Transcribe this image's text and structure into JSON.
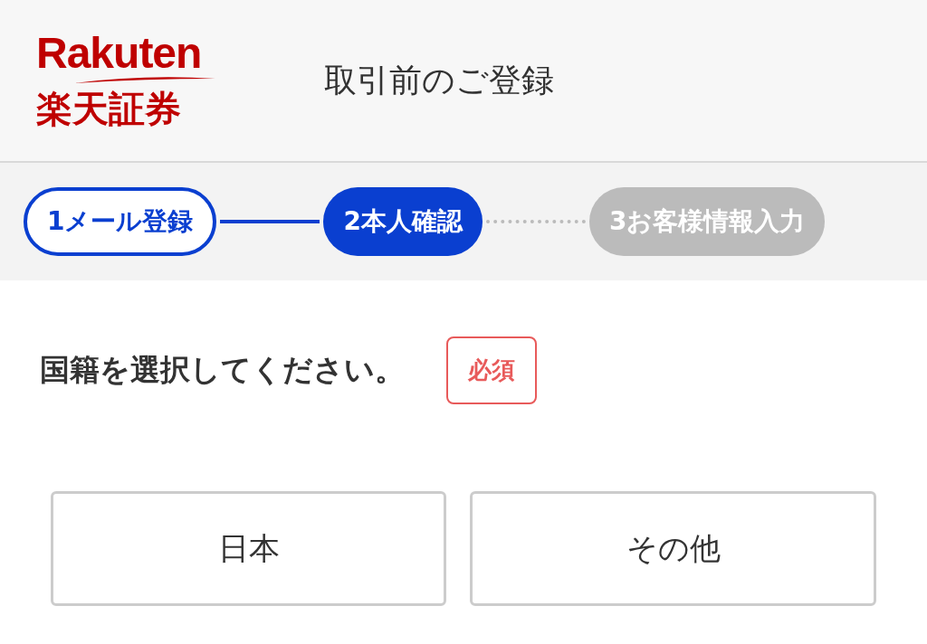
{
  "header": {
    "logo_wordmark": "Rakuten",
    "logo_subtitle": "楽天証券",
    "title": "取引前のご登録"
  },
  "steps": [
    {
      "number": "1",
      "label": "メール登録",
      "kind": "done"
    },
    {
      "number": "2",
      "label": "本人確認",
      "kind": "current"
    },
    {
      "number": "3",
      "label": "お客様情報入力",
      "kind": "upcoming"
    }
  ],
  "question": {
    "label": "国籍を選択してください。",
    "badge": "必須"
  },
  "options": [
    {
      "label": "日本",
      "selected": false
    },
    {
      "label": "その他",
      "selected": false
    }
  ]
}
